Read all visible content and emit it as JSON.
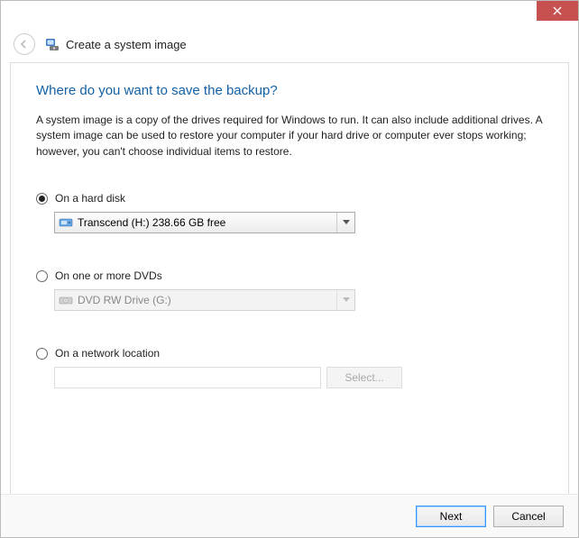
{
  "window": {
    "title": "Create a system image"
  },
  "page": {
    "heading": "Where do you want to save the backup?",
    "description": "A system image is a copy of the drives required for Windows to run. It can also include additional drives. A system image can be used to restore your computer if your hard drive or computer ever stops working; however, you can't choose individual items to restore."
  },
  "options": {
    "hard_disk": {
      "label": "On a hard disk",
      "selected_drive": "Transcend (H:)  238.66 GB free",
      "checked": true
    },
    "dvd": {
      "label": "On one or more DVDs",
      "selected_drive": "DVD RW Drive (G:)",
      "checked": false
    },
    "network": {
      "label": "On a network location",
      "path": "",
      "select_button": "Select...",
      "checked": false
    }
  },
  "footer": {
    "next": "Next",
    "cancel": "Cancel"
  }
}
